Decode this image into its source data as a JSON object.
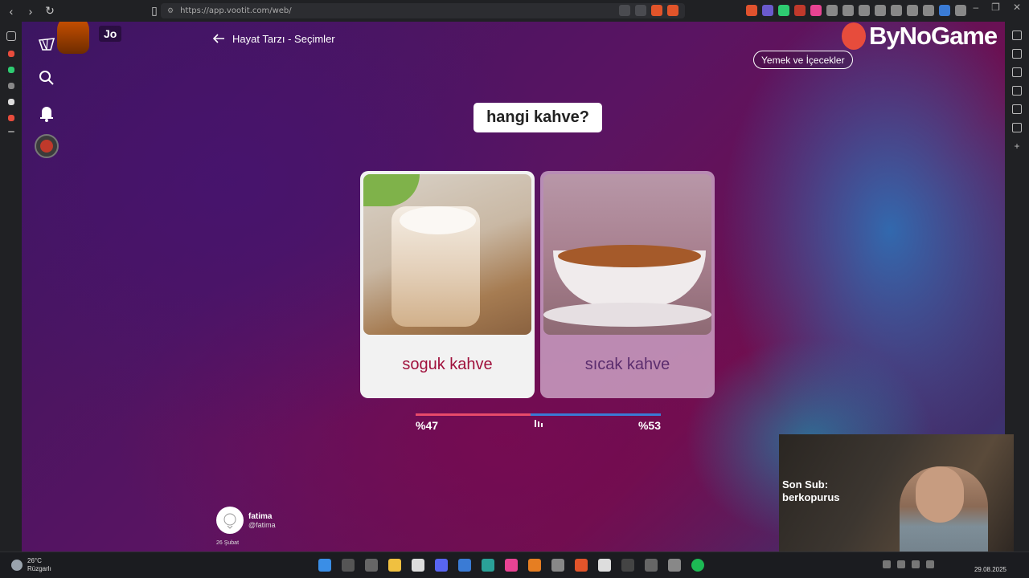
{
  "browser": {
    "url": "https://app.vootit.com/web/"
  },
  "app": {
    "user_initials": "Jo",
    "back_label": "Hayat Tarzı - Seçimler",
    "brand_name": "ByNoGame",
    "category": "Yemek ve İçecekler",
    "question": "hangi kahve?",
    "options": [
      {
        "label": "soguk kahve",
        "percent": "%47",
        "share": 47
      },
      {
        "label": "sıcak kahve",
        "percent": "%53",
        "share": 53
      }
    ],
    "author": {
      "name": "fatima",
      "handle": "@fatima",
      "date": "26 Şubat"
    }
  },
  "webcam": {
    "overlay_line1": "Son Sub:",
    "overlay_line2": "berkopurus"
  },
  "taskbar": {
    "weather_temp": "26°C",
    "weather_desc": "Rüzgarlı",
    "date": "29.08.2025"
  },
  "colors": {
    "left_accent": "#a0113c",
    "right_accent": "#5b2d6e",
    "bar_left": "#e84a6a",
    "bar_right": "#3a7bd5"
  }
}
